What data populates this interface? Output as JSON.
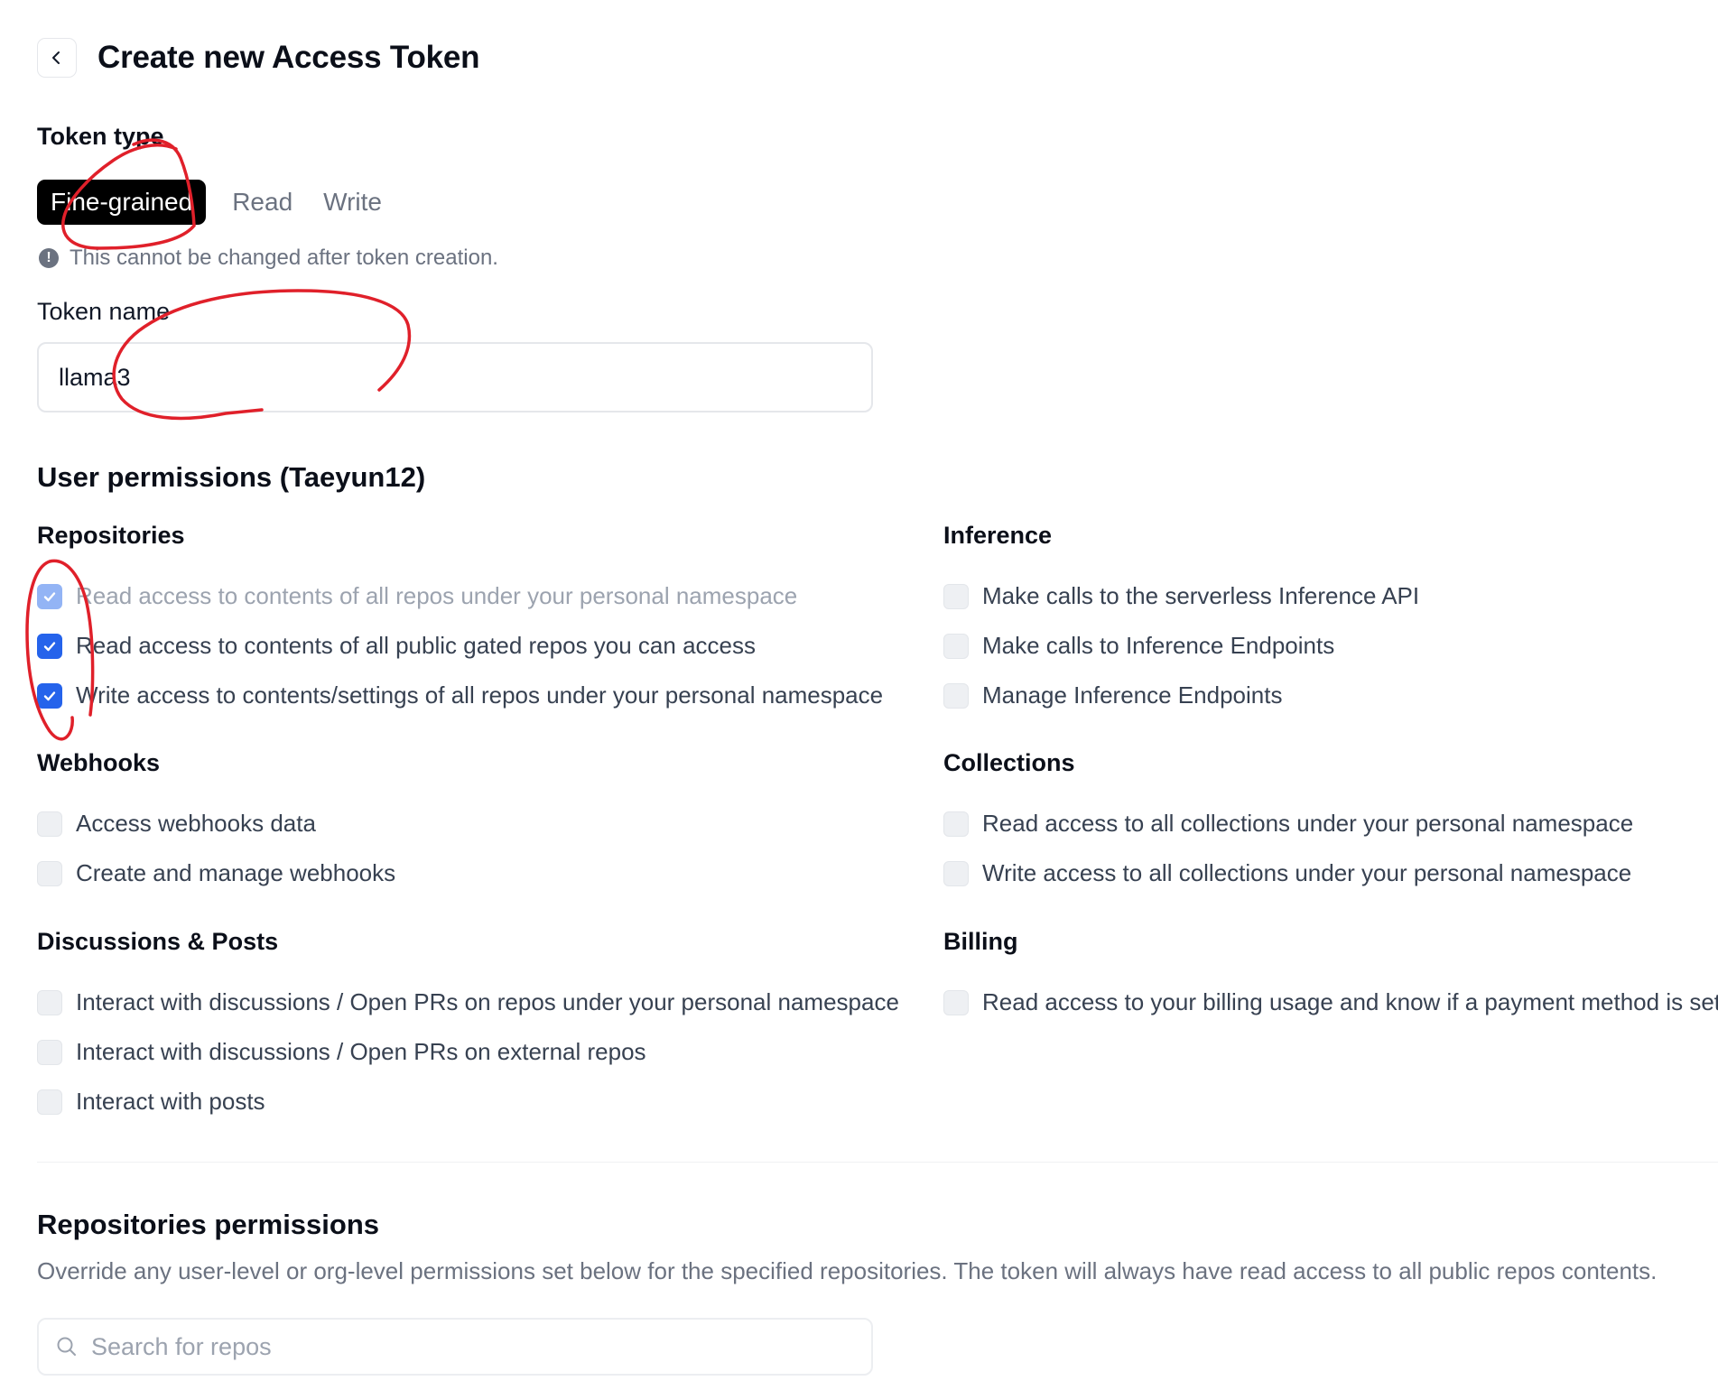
{
  "header": {
    "title": "Create new Access Token"
  },
  "token_type": {
    "label": "Token type",
    "tabs": [
      "Fine-grained",
      "Read",
      "Write"
    ],
    "active": "Fine-grained",
    "note": "This cannot be changed after token creation."
  },
  "token_name": {
    "label": "Token name",
    "value": "llama3"
  },
  "user_permissions": {
    "title": "User permissions (Taeyun12)",
    "repositories": {
      "title": "Repositories",
      "items": [
        {
          "label": "Read access to contents of all repos under your personal namespace",
          "checked": true,
          "disabled": true
        },
        {
          "label": "Read access to contents of all public gated repos you can access",
          "checked": true,
          "disabled": false
        },
        {
          "label": "Write access to contents/settings of all repos under your personal namespace",
          "checked": true,
          "disabled": false
        }
      ]
    },
    "inference": {
      "title": "Inference",
      "items": [
        {
          "label": "Make calls to the serverless Inference API",
          "checked": false
        },
        {
          "label": "Make calls to Inference Endpoints",
          "checked": false
        },
        {
          "label": "Manage Inference Endpoints",
          "checked": false
        }
      ]
    },
    "webhooks": {
      "title": "Webhooks",
      "items": [
        {
          "label": "Access webhooks data",
          "checked": false
        },
        {
          "label": "Create and manage webhooks",
          "checked": false
        }
      ]
    },
    "collections": {
      "title": "Collections",
      "items": [
        {
          "label": "Read access to all collections under your personal namespace",
          "checked": false
        },
        {
          "label": "Write access to all collections under your personal namespace",
          "checked": false
        }
      ]
    },
    "discussions": {
      "title": "Discussions & Posts",
      "items": [
        {
          "label": "Interact with discussions / Open PRs on repos under your personal namespace",
          "checked": false
        },
        {
          "label": "Interact with discussions / Open PRs on external repos",
          "checked": false
        },
        {
          "label": "Interact with posts",
          "checked": false
        }
      ]
    },
    "billing": {
      "title": "Billing",
      "items": [
        {
          "label": "Read access to your billing usage and know if a payment method is set",
          "checked": false
        }
      ]
    }
  },
  "repositories_permissions": {
    "title": "Repositories permissions",
    "description": "Override any user-level or org-level permissions set below for the specified repositories. The token will always have read access to all public repos contents.",
    "search_placeholder": "Search for repos"
  },
  "colors": {
    "accent": "#2563eb",
    "annotation": "#e0202a"
  },
  "icons": {
    "back": "chevron-left-icon",
    "info": "exclamation-circle-icon",
    "search": "search-icon",
    "check": "check-icon"
  }
}
